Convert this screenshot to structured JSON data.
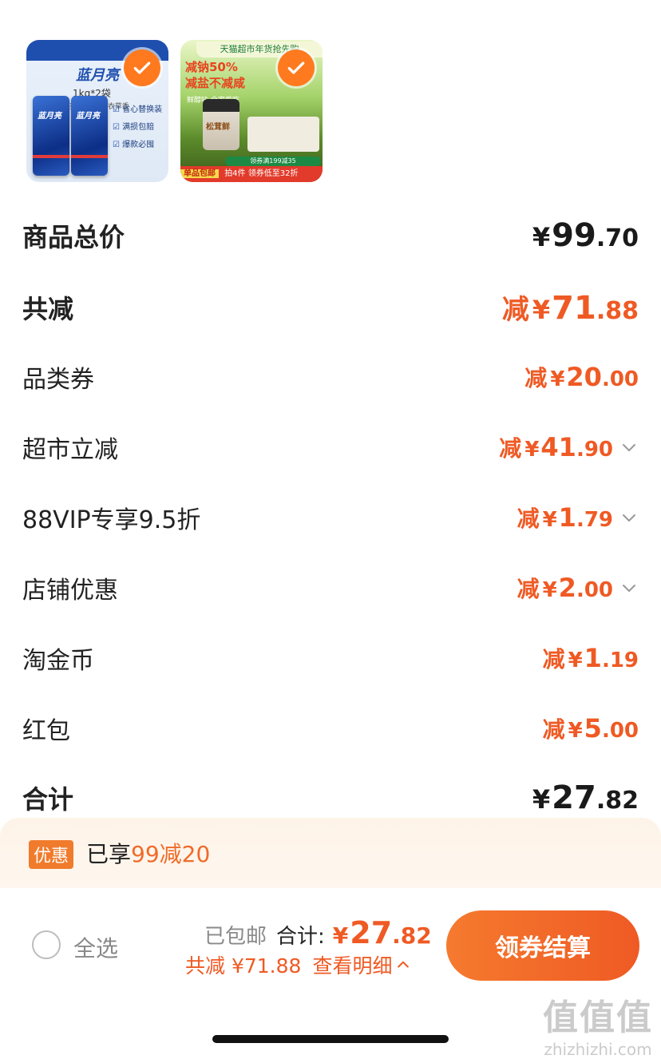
{
  "products": [
    {
      "brand": "蓝月亮",
      "spec": "1kg*2袋",
      "subtitle": "亮白增艳 薰衣草香",
      "features": [
        "省心替换装",
        "满损包赔",
        "爆款必囤"
      ],
      "selected": true
    },
    {
      "banner": "天猫超市年货抢先购",
      "headline_1": "减钠50%",
      "headline_2": "减盐不减咸",
      "tagline": "鲜醇味 全家爱吃",
      "jar_label": "松茸鲜",
      "coupon_note": "领券满199减35",
      "free_shipping": "单品包邮",
      "bottom_text": "拍4件 领券低至32折",
      "selected": true
    }
  ],
  "summary": {
    "total_label": "商品总价",
    "total": {
      "cur": "¥",
      "int": "99",
      "dec": ".70"
    },
    "saved_label": "共减",
    "saved": {
      "pre": "减",
      "cur": "¥",
      "int": "71",
      "dec": ".88"
    }
  },
  "discounts": [
    {
      "label": "品类券",
      "pre": "减",
      "cur": "¥",
      "int": "20",
      "dec": ".00",
      "expandable": false
    },
    {
      "label": "超市立减",
      "pre": "减",
      "cur": "¥",
      "int": "41",
      "dec": ".90",
      "expandable": true
    },
    {
      "label": "88VIP专享9.5折",
      "pre": "减",
      "cur": "¥",
      "int": "1",
      "dec": ".79",
      "expandable": true
    },
    {
      "label": "店铺优惠",
      "pre": "减",
      "cur": "¥",
      "int": "2",
      "dec": ".00",
      "expandable": true
    },
    {
      "label": "淘金币",
      "pre": "减",
      "cur": "¥",
      "int": "1",
      "dec": ".19",
      "expandable": false
    },
    {
      "label": "红包",
      "pre": "减",
      "cur": "¥",
      "int": "5",
      "dec": ".00",
      "expandable": false
    }
  ],
  "grand_total": {
    "label": "合计",
    "cur": "¥",
    "int": "27",
    "dec": ".82"
  },
  "promo": {
    "badge": "优惠",
    "text": "已享",
    "highlight": "99减20"
  },
  "bottom_bar": {
    "select_all": "全选",
    "shipped": "已包邮",
    "sum_label": "合计:",
    "sum_cur": "¥",
    "sum_int": "27",
    "sum_dec": ".82",
    "reduced": "共减 ¥71.88",
    "detail": "查看明细",
    "checkout": "领券结算"
  },
  "watermark": {
    "big": "值值值",
    "small": "zhizhizhi.com"
  },
  "colors": {
    "accent": "#ef5a24",
    "check": "#ff7a1f",
    "promo_bg": "#fdf3e8"
  }
}
